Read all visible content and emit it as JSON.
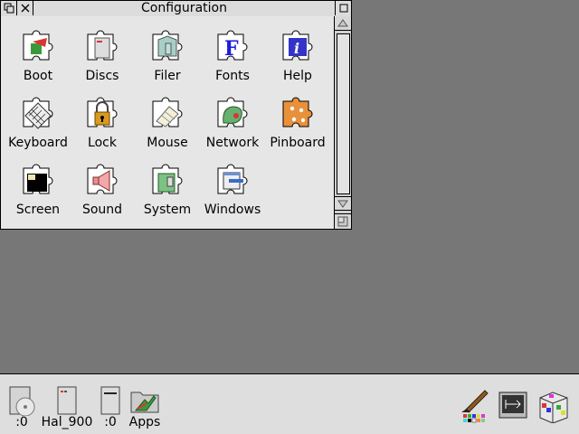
{
  "window": {
    "title": "Configuration",
    "items": [
      {
        "label": "Boot"
      },
      {
        "label": "Discs"
      },
      {
        "label": "Filer"
      },
      {
        "label": "Fonts"
      },
      {
        "label": "Help"
      },
      {
        "label": "Keyboard"
      },
      {
        "label": "Lock"
      },
      {
        "label": "Mouse"
      },
      {
        "label": "Network"
      },
      {
        "label": "Pinboard"
      },
      {
        "label": "Screen"
      },
      {
        "label": "Sound"
      },
      {
        "label": "System"
      },
      {
        "label": "Windows"
      }
    ]
  },
  "iconbar": {
    "left": [
      {
        "label": ":0"
      },
      {
        "label": "Hal_900"
      },
      {
        "label": ":0"
      },
      {
        "label": "Apps"
      }
    ]
  },
  "colors": {
    "desktop": "#777777",
    "window_bg": "#e6e6e6",
    "accent_blue": "#2b2bd0",
    "accent_orange": "#e08a3a"
  }
}
